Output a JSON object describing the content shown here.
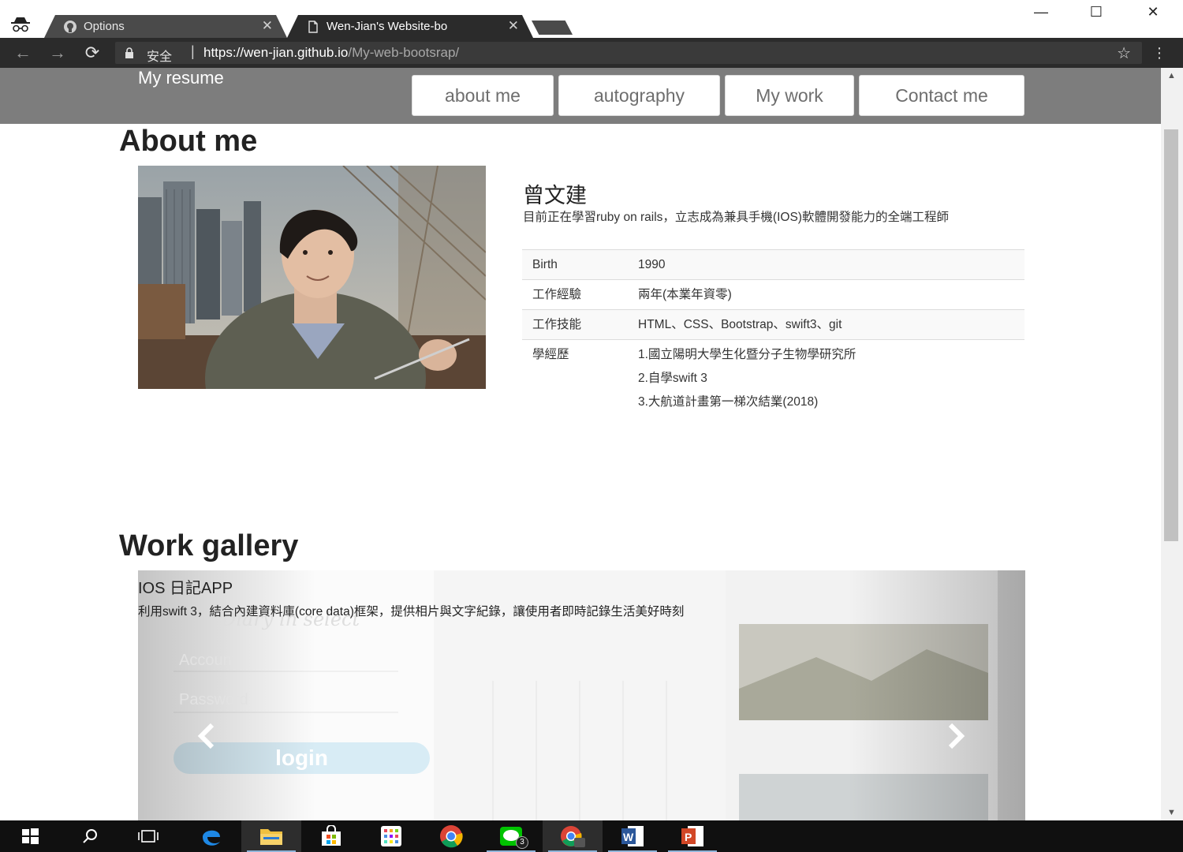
{
  "browser": {
    "tabs": [
      {
        "title": "Options",
        "close": "✕"
      },
      {
        "title": "Wen-Jian's Website-bo",
        "close": "✕"
      }
    ],
    "window_controls": {
      "minimize": "—",
      "maximize": "☐",
      "close": "✕"
    },
    "nav": {
      "back": "←",
      "forward": "→",
      "reload": "⟳"
    },
    "address": {
      "security_label": "安全",
      "separator": "|",
      "url_host": "https://wen-jian.github.io",
      "url_path": "/My-web-bootsrap/"
    },
    "bookmark_star": "☆",
    "menu_dots": "⋮"
  },
  "site": {
    "brand": "My resume",
    "nav_buttons": [
      "about me",
      "autography",
      "My work",
      "Contact me"
    ]
  },
  "about": {
    "heading": "About me",
    "name": "曾文建",
    "intro": "目前正在學習ruby on rails，立志成為兼具手機(IOS)軟體開發能力的全端工程師",
    "table": [
      {
        "key": "Birth",
        "value": "1990"
      },
      {
        "key": "工作經驗",
        "value": "兩年(本業年資零)"
      },
      {
        "key": "工作技能",
        "value": "HTML、CSS、Bootstrap、swift3、git"
      }
    ],
    "education": {
      "key": "學經歷",
      "items": [
        "1.國立陽明大學生化暨分子生物學研究所",
        "2.自學swift 3",
        "3.大航道計畫第一梯次結業(2018)"
      ]
    }
  },
  "gallery": {
    "heading": "Work gallery",
    "slide": {
      "title": "IOS 日記APP",
      "description": "利用swift 3，結合內建資料庫(core data)框架，提供相片與文字紀錄，讓使用者即時記錄生活美好時刻",
      "login_label": "login",
      "account_placeholder": "Account",
      "password_placeholder": "Password",
      "app_title": "Diary in select"
    }
  },
  "scroll": {
    "up": "▲",
    "down": "▼"
  },
  "taskbar": {
    "line_badge": "3"
  },
  "colors": {
    "navbar_bg": "#7d7d7d",
    "chrome_dark": "#2b2b2b",
    "taskbar": "#101010"
  }
}
